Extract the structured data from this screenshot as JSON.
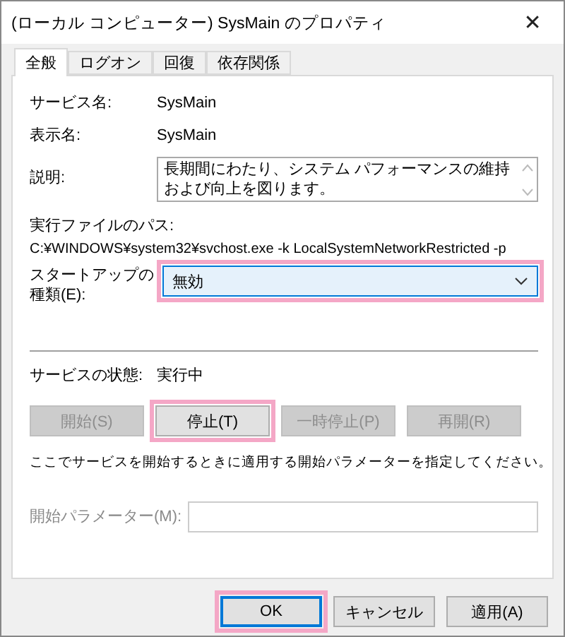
{
  "window": {
    "title": "(ローカル コンピューター) SysMain のプロパティ",
    "close": "✕"
  },
  "tabs": [
    {
      "label": "全般",
      "selected": true
    },
    {
      "label": "ログオン",
      "selected": false
    },
    {
      "label": "回復",
      "selected": false
    },
    {
      "label": "依存関係",
      "selected": false
    }
  ],
  "service_name": {
    "label": "サービス名:",
    "value": "SysMain"
  },
  "display_name": {
    "label": "表示名:",
    "value": "SysMain"
  },
  "description": {
    "label": "説明:",
    "value": "長期間にわたり、システム パフォーマンスの維持および向上を図ります。"
  },
  "executable_path": {
    "label": "実行ファイルのパス:",
    "value": "C:¥WINDOWS¥system32¥svchost.exe -k LocalSystemNetworkRestricted -p"
  },
  "startup_type": {
    "label": "スタートアップの種類(E):",
    "value": "無効",
    "highlighted": true
  },
  "service_status": {
    "label": "サービスの状態:",
    "value": "実行中"
  },
  "service_buttons": [
    {
      "label": "開始(S)",
      "disabled": true,
      "highlighted": false
    },
    {
      "label": "停止(T)",
      "disabled": false,
      "highlighted": true
    },
    {
      "label": "一時停止(P)",
      "disabled": true,
      "highlighted": false
    },
    {
      "label": "再開(R)",
      "disabled": true,
      "highlighted": false
    }
  ],
  "hint": "ここでサービスを開始するときに適用する開始パラメーターを指定してください。",
  "start_parameters": {
    "label": "開始パラメーター(M):",
    "disabled": true
  },
  "dialog_buttons": [
    {
      "label": "OK",
      "default": true,
      "highlighted": true
    },
    {
      "label": "キャンセル",
      "default": false,
      "highlighted": false
    },
    {
      "label": "適用(A)",
      "default": false,
      "highlighted": false
    }
  ]
}
